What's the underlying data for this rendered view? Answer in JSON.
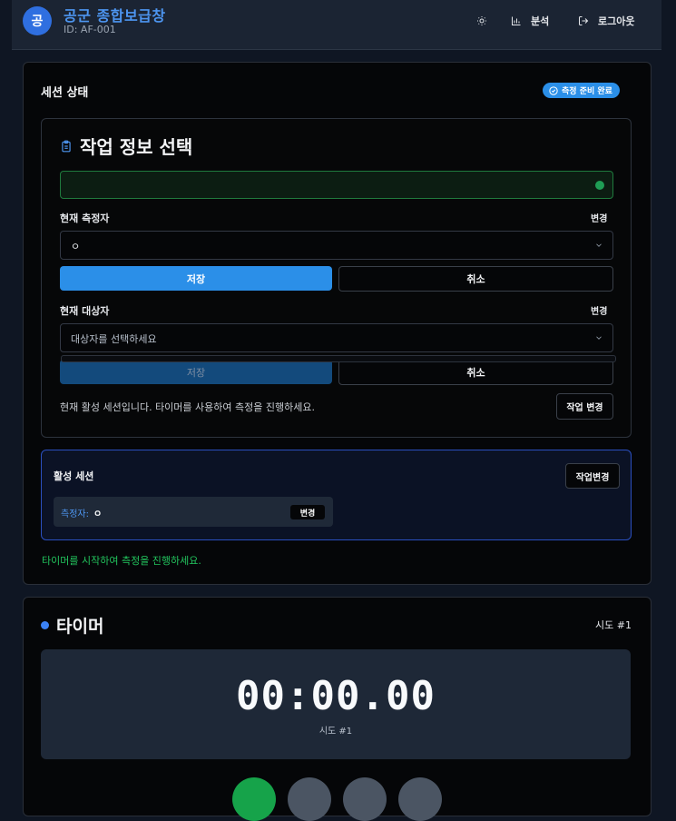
{
  "header": {
    "logo_char": "공",
    "title": "공군 종합보급창",
    "id": "ID: AF-001",
    "theme_icon": "sun-icon",
    "analysis_label": "분석",
    "logout_label": "로그아웃"
  },
  "session": {
    "title": "세션 상태",
    "badge": "측정 준비 완료"
  },
  "task": {
    "title": "작업 정보 선택",
    "measurer_label": "현재 측정자",
    "measurer_change": "변경",
    "measurer_value": "ㅇ",
    "save_label": "저장",
    "cancel_label": "취소",
    "target_label": "현재 대상자",
    "target_change": "변경",
    "target_placeholder": "대상자를 선택하세요",
    "save2_label": "저장",
    "cancel2_label": "취소",
    "info_text": "현재 활성 세션입니다. 타이머를 사용하여 측정을 진행하세요.",
    "task_change_label": "작업 변경"
  },
  "active_session": {
    "title": "활성 세션",
    "change_task_label": "작업변경",
    "measurer_key": "측정자:",
    "measurer_value": "ㅇ",
    "change_label": "변경",
    "hint": "타이머를 시작하여 측정을 진행하세요."
  },
  "timer": {
    "title": "타이머",
    "attempt": "시도 #1",
    "time": "00:00.00",
    "attempt_sub": "시도 #1"
  },
  "colors": {
    "accent": "#2b8fe8",
    "success": "#22c55e",
    "brand": "#2f6fe0"
  }
}
